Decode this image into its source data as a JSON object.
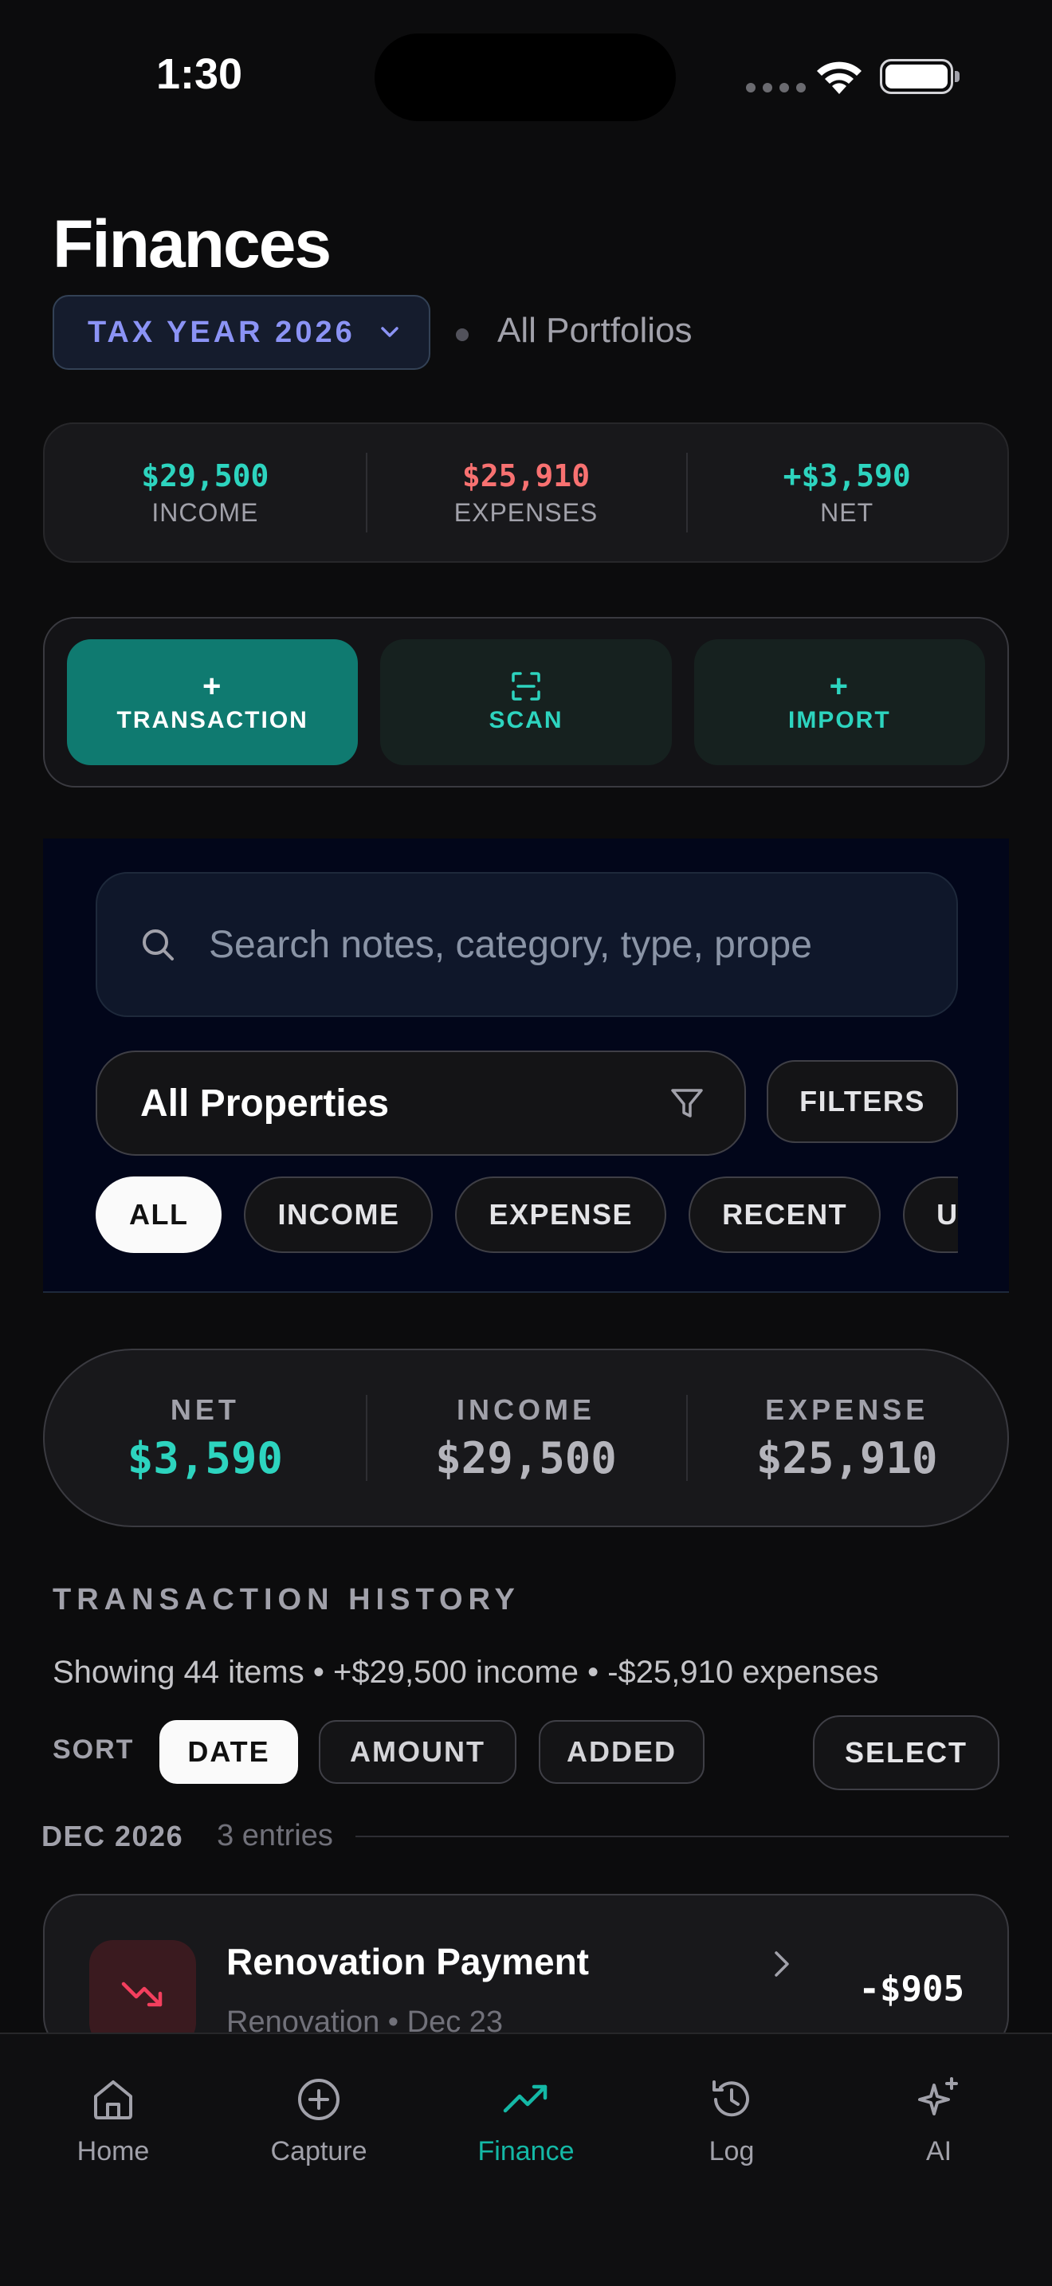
{
  "status_bar": {
    "time": "1:30"
  },
  "header": {
    "title": "Finances",
    "tax_year": "TAX YEAR 2026",
    "portfolio": "All Portfolios"
  },
  "summary": {
    "income_value": "$29,500",
    "income_label": "INCOME",
    "expenses_value": "$25,910",
    "expenses_label": "EXPENSES",
    "net_value": "+$3,590",
    "net_label": "NET"
  },
  "actions": {
    "transaction": "TRANSACTION",
    "scan": "SCAN",
    "import": "IMPORT",
    "plus": "+"
  },
  "search": {
    "placeholder": "Search notes, category, type, prope",
    "property_select": "All Properties",
    "filters": "FILTERS",
    "chips": [
      "ALL",
      "INCOME",
      "EXPENSE",
      "RECENT",
      "U"
    ]
  },
  "net_pill": {
    "net_label": "NET",
    "net_value": "$3,590",
    "income_label": "INCOME",
    "income_value": "$29,500",
    "expense_label": "EXPENSE",
    "expense_value": "$25,910"
  },
  "history": {
    "title": "TRANSACTION HISTORY",
    "summary": "Showing 44 items • +$29,500 income • -$25,910 expenses",
    "sort_label": "SORT",
    "sort_options": [
      "DATE",
      "AMOUNT",
      "ADDED"
    ],
    "select": "SELECT",
    "month": "DEC 2026",
    "month_count": "3 entries",
    "transactions": [
      {
        "title": "Renovation Payment",
        "subtitle": "Renovation • Dec 23",
        "amount": "-$905"
      }
    ]
  },
  "tabbar": {
    "tabs": [
      "Home",
      "Capture",
      "Finance",
      "Log",
      "AI"
    ]
  },
  "colors": {
    "accent": "#14b8a6",
    "income": "#2dd4bf",
    "expense": "#f87171",
    "tax_year": "#8b93f5"
  }
}
